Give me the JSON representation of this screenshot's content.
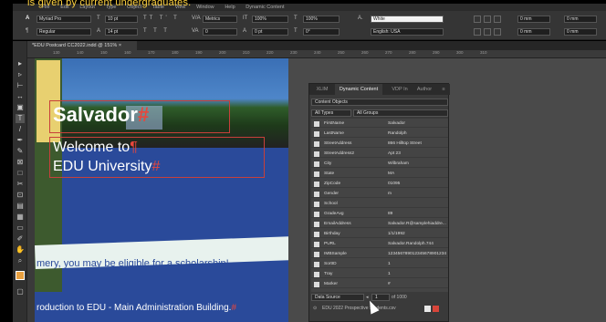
{
  "caption": "is given by current undergraduates.",
  "menubar": [
    "File",
    "Edit",
    "Layout",
    "Type",
    "Object",
    "Table",
    "View",
    "Window",
    "Help",
    "Dynamic Content"
  ],
  "control": {
    "font_family": "Myriad Pro",
    "font_style": "Regular",
    "font_size": "10 pt",
    "leading": "14 pt",
    "kerning": "Metrics",
    "tracking": "0",
    "scale_h": "100%",
    "scale_v": "100%",
    "baseline": "0 pt",
    "skew": "0°",
    "fill_label": "White",
    "language": "English: USA",
    "indent_left": "0 mm",
    "indent_right": "0 mm",
    "space_before": "0 mm",
    "space_after": "0 mm"
  },
  "document_tab": "*EDU Postcard CC2022.indd @ 151%",
  "ruler": [
    "130",
    "140",
    "150",
    "160",
    "170",
    "180",
    "190",
    "200",
    "210",
    "220",
    "230",
    "240",
    "250",
    "260",
    "270",
    "280",
    "290",
    "300",
    "310"
  ],
  "page": {
    "name": "Salvador",
    "welcome": "Welcome to",
    "university": "EDU University",
    "scholarship": "mery, you may be eligible for a scholarship!",
    "intro": "roduction to EDU - Main Administration Building."
  },
  "panel": {
    "tabs": [
      "XLIM",
      "Dynamic Content",
      "VDP In",
      "Author"
    ],
    "content_objects": "Content Objects",
    "filter_types": "All Types",
    "filter_groups": "All Groups",
    "fields": [
      {
        "name": "FirstName",
        "value": "Salvador"
      },
      {
        "name": "LastName",
        "value": "Randolph"
      },
      {
        "name": "StreetAddress",
        "value": "866 Hilltop Street"
      },
      {
        "name": "StreetAddress2",
        "value": "Apt 23"
      },
      {
        "name": "City",
        "value": "Wilbraham"
      },
      {
        "name": "State",
        "value": "MA"
      },
      {
        "name": "ZipCode",
        "value": "01095"
      },
      {
        "name": "Gender",
        "value": "m"
      },
      {
        "name": "School",
        "value": ""
      },
      {
        "name": "GradeAvg",
        "value": "89"
      },
      {
        "name": "EmailAddress",
        "value": "Salvador.R@samplehiaddre..."
      },
      {
        "name": "Birthday",
        "value": "1/1/1992"
      },
      {
        "name": "PURL",
        "value": "Salvador.Randolph.744"
      },
      {
        "name": "IMBSample",
        "value": "1234567890123456789012345..."
      },
      {
        "name": "SortID",
        "value": "1"
      },
      {
        "name": "Tray",
        "value": "1"
      },
      {
        "name": "Marker",
        "value": "#"
      }
    ],
    "data_source_label": "Data Source",
    "record": "1",
    "record_total": "of 1000",
    "file_name": "EDU 2022 Prospective S...dents.csv"
  }
}
